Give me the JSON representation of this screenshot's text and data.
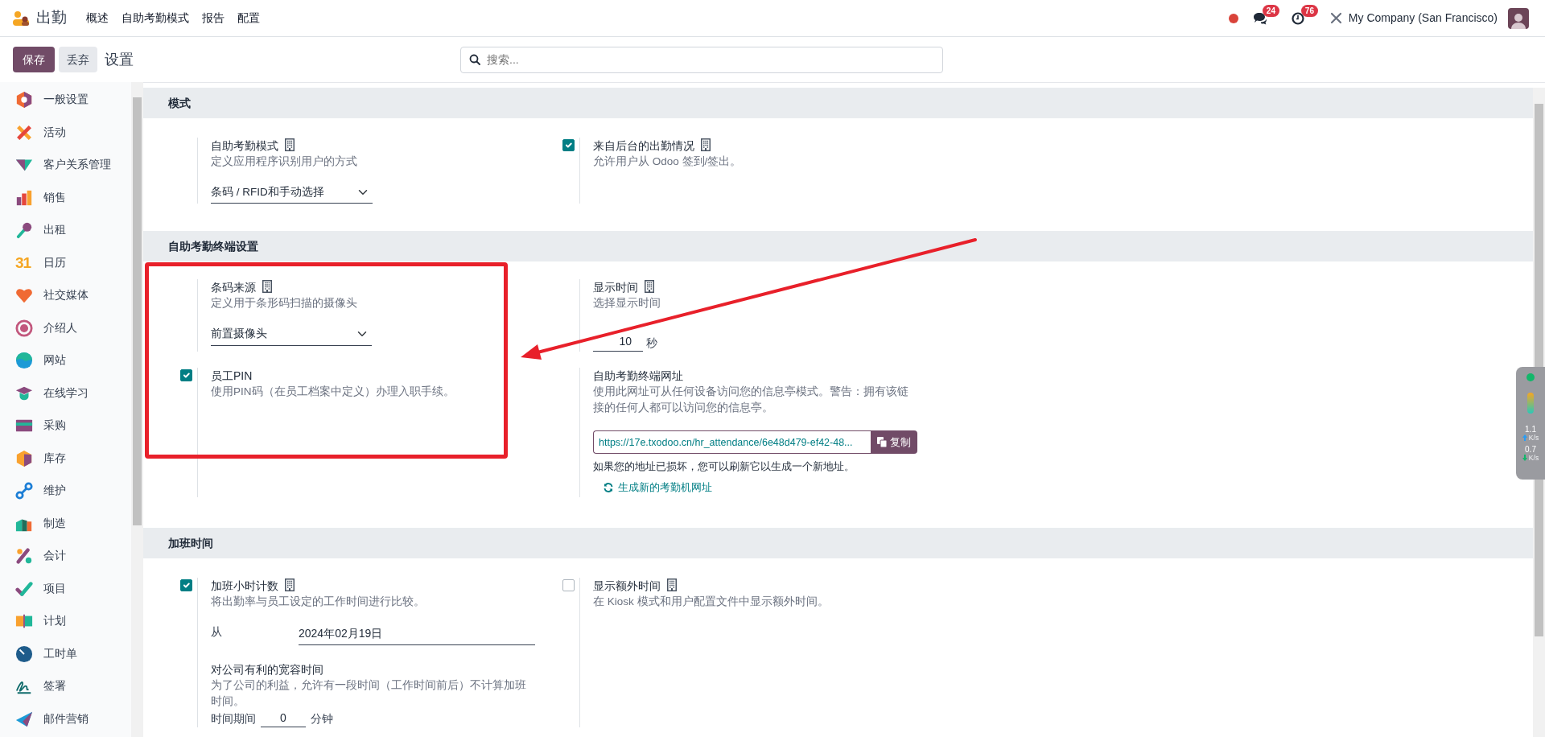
{
  "app": {
    "name": "出勤",
    "menu": [
      "概述",
      "自助考勤模式",
      "报告",
      "配置"
    ]
  },
  "systray": {
    "chat_count": "24",
    "activity_count": "76",
    "company": "My Company (San Francisco)"
  },
  "control_panel": {
    "buttons": [
      {
        "label": "保存",
        "kind": "primary"
      },
      {
        "label": "丢弃",
        "kind": "secondary"
      }
    ],
    "title": "设置",
    "search": {
      "placeholder": "搜索..."
    }
  },
  "sidebar": {
    "items": [
      {
        "label": "一般设置"
      },
      {
        "label": "活动"
      },
      {
        "label": "客户关系管理"
      },
      {
        "label": "销售"
      },
      {
        "label": "出租"
      },
      {
        "label": "日历",
        "icon_text": "31"
      },
      {
        "label": "社交媒体"
      },
      {
        "label": "介绍人"
      },
      {
        "label": "网站"
      },
      {
        "label": "在线学习"
      },
      {
        "label": "采购"
      },
      {
        "label": "库存"
      },
      {
        "label": "维护"
      },
      {
        "label": "制造"
      },
      {
        "label": "会计"
      },
      {
        "label": "项目"
      },
      {
        "label": "计划"
      },
      {
        "label": "工时单"
      },
      {
        "label": "签署"
      },
      {
        "label": "邮件营销"
      }
    ]
  },
  "sections": [
    {
      "title": "模式",
      "settings": [
        {
          "kind": "plain",
          "title": "自助考勤模式",
          "company_dependent": true,
          "description": "定义应用程序识别用户的方式",
          "fields": [
            {
              "kind": "select",
              "value": "条码 / RFID和手动选择"
            }
          ]
        },
        {
          "kind": "checkbox",
          "checked": true,
          "title": "来自后台的出勤情况",
          "company_dependent": true,
          "description": "允许用户从 Odoo 签到/签出。"
        }
      ]
    },
    {
      "title": "自助考勤终端设置",
      "settings": [
        {
          "kind": "plain",
          "title": "条码来源",
          "company_dependent": true,
          "description": "定义用于条形码扫描的摄像头",
          "fields": [
            {
              "kind": "select",
              "value": "前置摄像头"
            }
          ]
        },
        {
          "kind": "plain",
          "title": "显示时间",
          "company_dependent": true,
          "description": "选择显示时间",
          "fields": [
            {
              "kind": "number",
              "value": "10",
              "unit": "秒"
            }
          ]
        },
        {
          "kind": "checkbox",
          "checked": true,
          "title": "员工PIN",
          "company_dependent": false,
          "description": "使用PIN码（在员工档案中定义）办理入职手续。"
        },
        {
          "kind": "plain",
          "title": "自助考勤终端网址",
          "company_dependent": false,
          "description": "使用此网址可从任何设备访问您的信息亭模式。警告：拥有该链接的任何人都可以访问您的信息亭。",
          "fields": [
            {
              "kind": "url",
              "value": "https://17e.txodoo.cn/hr_attendance/6e48d479-ef42-48...",
              "button": "复制"
            },
            {
              "kind": "note",
              "text": "如果您的地址已损坏，您可以刷新它以生成一个新地址。"
            },
            {
              "kind": "link",
              "text": "生成新的考勤机网址"
            }
          ]
        }
      ]
    },
    {
      "title": "加班时间",
      "settings": [
        {
          "kind": "checkbox",
          "checked": true,
          "title": "加班小时计数",
          "company_dependent": true,
          "description": "将出勤率与员工设定的工作时间进行比较。",
          "fields": [
            {
              "kind": "date",
              "label": "从",
              "value": "2024年02月19日"
            },
            {
              "kind": "heading",
              "text": "对公司有利的宽容时间"
            },
            {
              "kind": "description",
              "text": "为了公司的利益，允许有一段时间（工作时间前后）不计算加班时间。"
            },
            {
              "kind": "duration",
              "label": "时间期间",
              "value": "0",
              "unit": "分钟"
            }
          ]
        },
        {
          "kind": "checkbox",
          "checked": false,
          "title": "显示额外时间",
          "company_dependent": true,
          "description": "在 Kiosk 模式和用户配置文件中显示额外时间。"
        }
      ]
    }
  ],
  "annotations": {
    "highlight_frame": true,
    "arrow": true
  },
  "speed_widget": {
    "upload": "1.1",
    "upload_unit": "K/s",
    "download": "0.7",
    "download_unit": "K/s"
  }
}
